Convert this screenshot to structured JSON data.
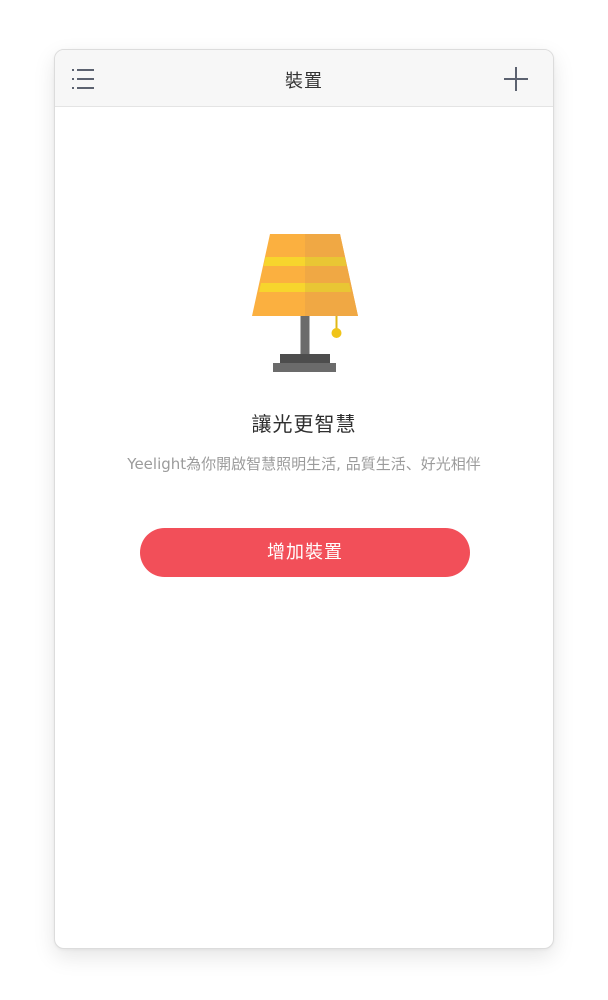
{
  "header": {
    "title": "裝置",
    "menu_icon": "list-menu-icon",
    "add_icon": "plus-icon"
  },
  "empty_state": {
    "illustration": "table-lamp-icon",
    "headline": "讓光更智慧",
    "subtitle": "Yeelight為你開啟智慧照明生活, 品質生活、好光相伴",
    "button_label": "增加裝置"
  },
  "colors": {
    "accent": "#f24f59",
    "lamp_shade": "#fbb040",
    "lamp_stripe": "#f7d52d",
    "lamp_base": "#5f5f5f"
  }
}
